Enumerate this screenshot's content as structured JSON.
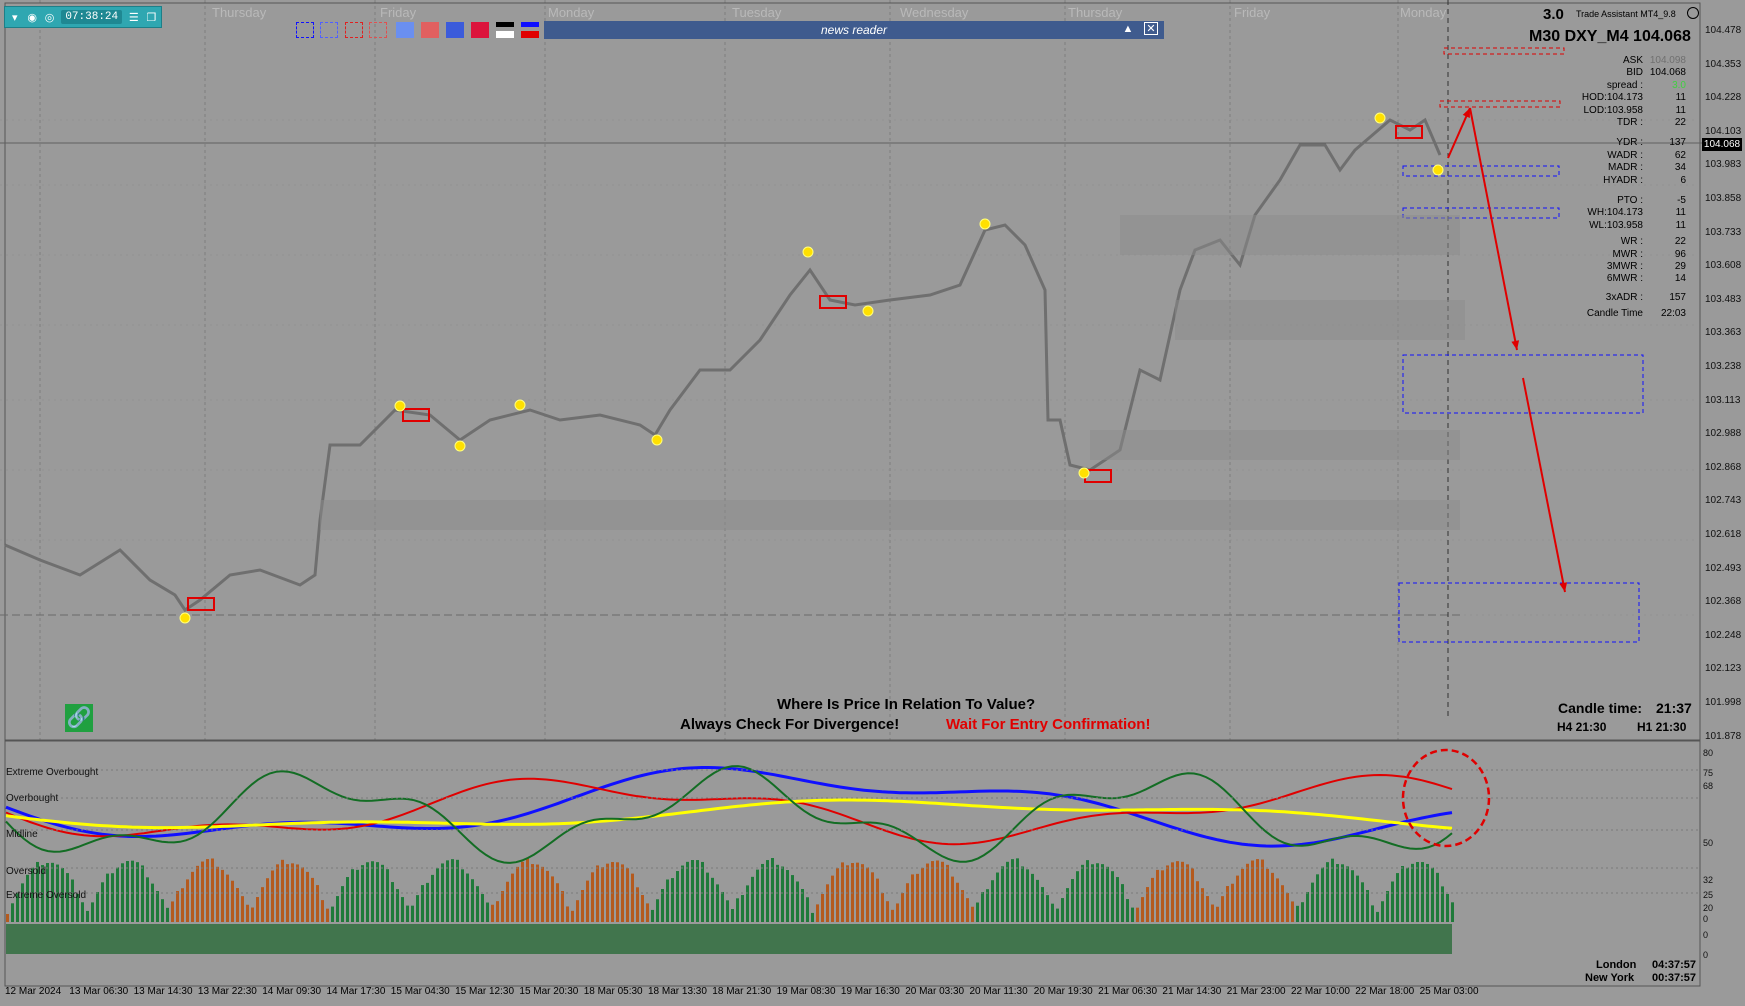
{
  "toolbar": {
    "time": "07:38:24"
  },
  "news_reader": {
    "title": "news reader"
  },
  "day_labels": [
    "Thursday",
    "Friday",
    "Monday",
    "Tuesday",
    "Wednesday",
    "Thursday",
    "Friday",
    "Monday"
  ],
  "price_axis": [
    "104.478",
    "104.353",
    "104.228",
    "104.103",
    "103.983",
    "103.858",
    "103.733",
    "103.608",
    "103.483",
    "103.363",
    "103.238",
    "103.113",
    "102.988",
    "102.868",
    "102.743",
    "102.618",
    "102.493",
    "102.368",
    "102.248",
    "102.123",
    "101.998",
    "101.878"
  ],
  "current_price_tag": "104.068",
  "header": {
    "spread_top": "3.0",
    "ea_name": "Trade Assistant MT4_9.8",
    "symbol_line": "M30 DXY_M4 104.068"
  },
  "stats": [
    {
      "label": "ASK",
      "value": "104.098"
    },
    {
      "label": "BID",
      "value": "104.068"
    },
    {
      "label": "spread :",
      "value": "3.0"
    },
    {
      "label": "HOD:104.173",
      "value": "11"
    },
    {
      "label": "LOD:103.958",
      "value": "11"
    },
    {
      "label": "TDR :",
      "value": "22"
    },
    {
      "label": "YDR :",
      "value": "137"
    },
    {
      "label": "WADR :",
      "value": "62"
    },
    {
      "label": "MADR :",
      "value": "34"
    },
    {
      "label": "HYADR :",
      "value": "6"
    },
    {
      "label": "PTO :",
      "value": "-5"
    },
    {
      "label": "WH:104.173",
      "value": "11"
    },
    {
      "label": "WL:103.958",
      "value": "11"
    },
    {
      "label": "WR :",
      "value": "22"
    },
    {
      "label": "MWR :",
      "value": "96"
    },
    {
      "label": "3MWR :",
      "value": "29"
    },
    {
      "label": "6MWR :",
      "value": "14"
    },
    {
      "label": "3xADR :",
      "value": "157"
    },
    {
      "label": "Candle Time",
      "value": "22:03"
    }
  ],
  "candle_time": {
    "label": "Candle time:",
    "value": "21:37",
    "h4": "H4 21:30",
    "h1": "H1 21:30"
  },
  "banners": {
    "line1": "Where Is Price In Relation To Value?",
    "line2": "Always Check For Divergence!",
    "line3": "Wait For Entry Confirmation!"
  },
  "indicator_labels": [
    "Extreme Overbought",
    "Overbought",
    "Midline",
    "Oversold",
    "Extreme Oversold"
  ],
  "osc_scale": [
    "80",
    "75",
    "68",
    "50",
    "32",
    "25",
    "20",
    "0",
    "0",
    "0"
  ],
  "sessions": [
    {
      "name": "London",
      "time": "04:37:57"
    },
    {
      "name": "New York",
      "time": "00:37:57"
    }
  ],
  "time_axis": [
    "12 Mar 2024",
    "13 Mar 06:30",
    "13 Mar 14:30",
    "13 Mar 22:30",
    "14 Mar 09:30",
    "14 Mar 17:30",
    "15 Mar 04:30",
    "15 Mar 12:30",
    "15 Mar 20:30",
    "18 Mar 05:30",
    "18 Mar 13:30",
    "18 Mar 21:30",
    "19 Mar 08:30",
    "19 Mar 16:30",
    "20 Mar 03:30",
    "20 Mar 11:30",
    "20 Mar 19:30",
    "21 Mar 06:30",
    "21 Mar 14:30",
    "21 Mar 23:00",
    "22 Mar 10:00",
    "22 Mar 18:00",
    "25 Mar 03:00"
  ],
  "colors": {
    "up": "#1f7a3a",
    "down": "#b45a1e",
    "accent": "#e00000",
    "blue_line": "#1010ff",
    "yellow_line": "#ffff00",
    "teal": "#2fa7b1"
  }
}
